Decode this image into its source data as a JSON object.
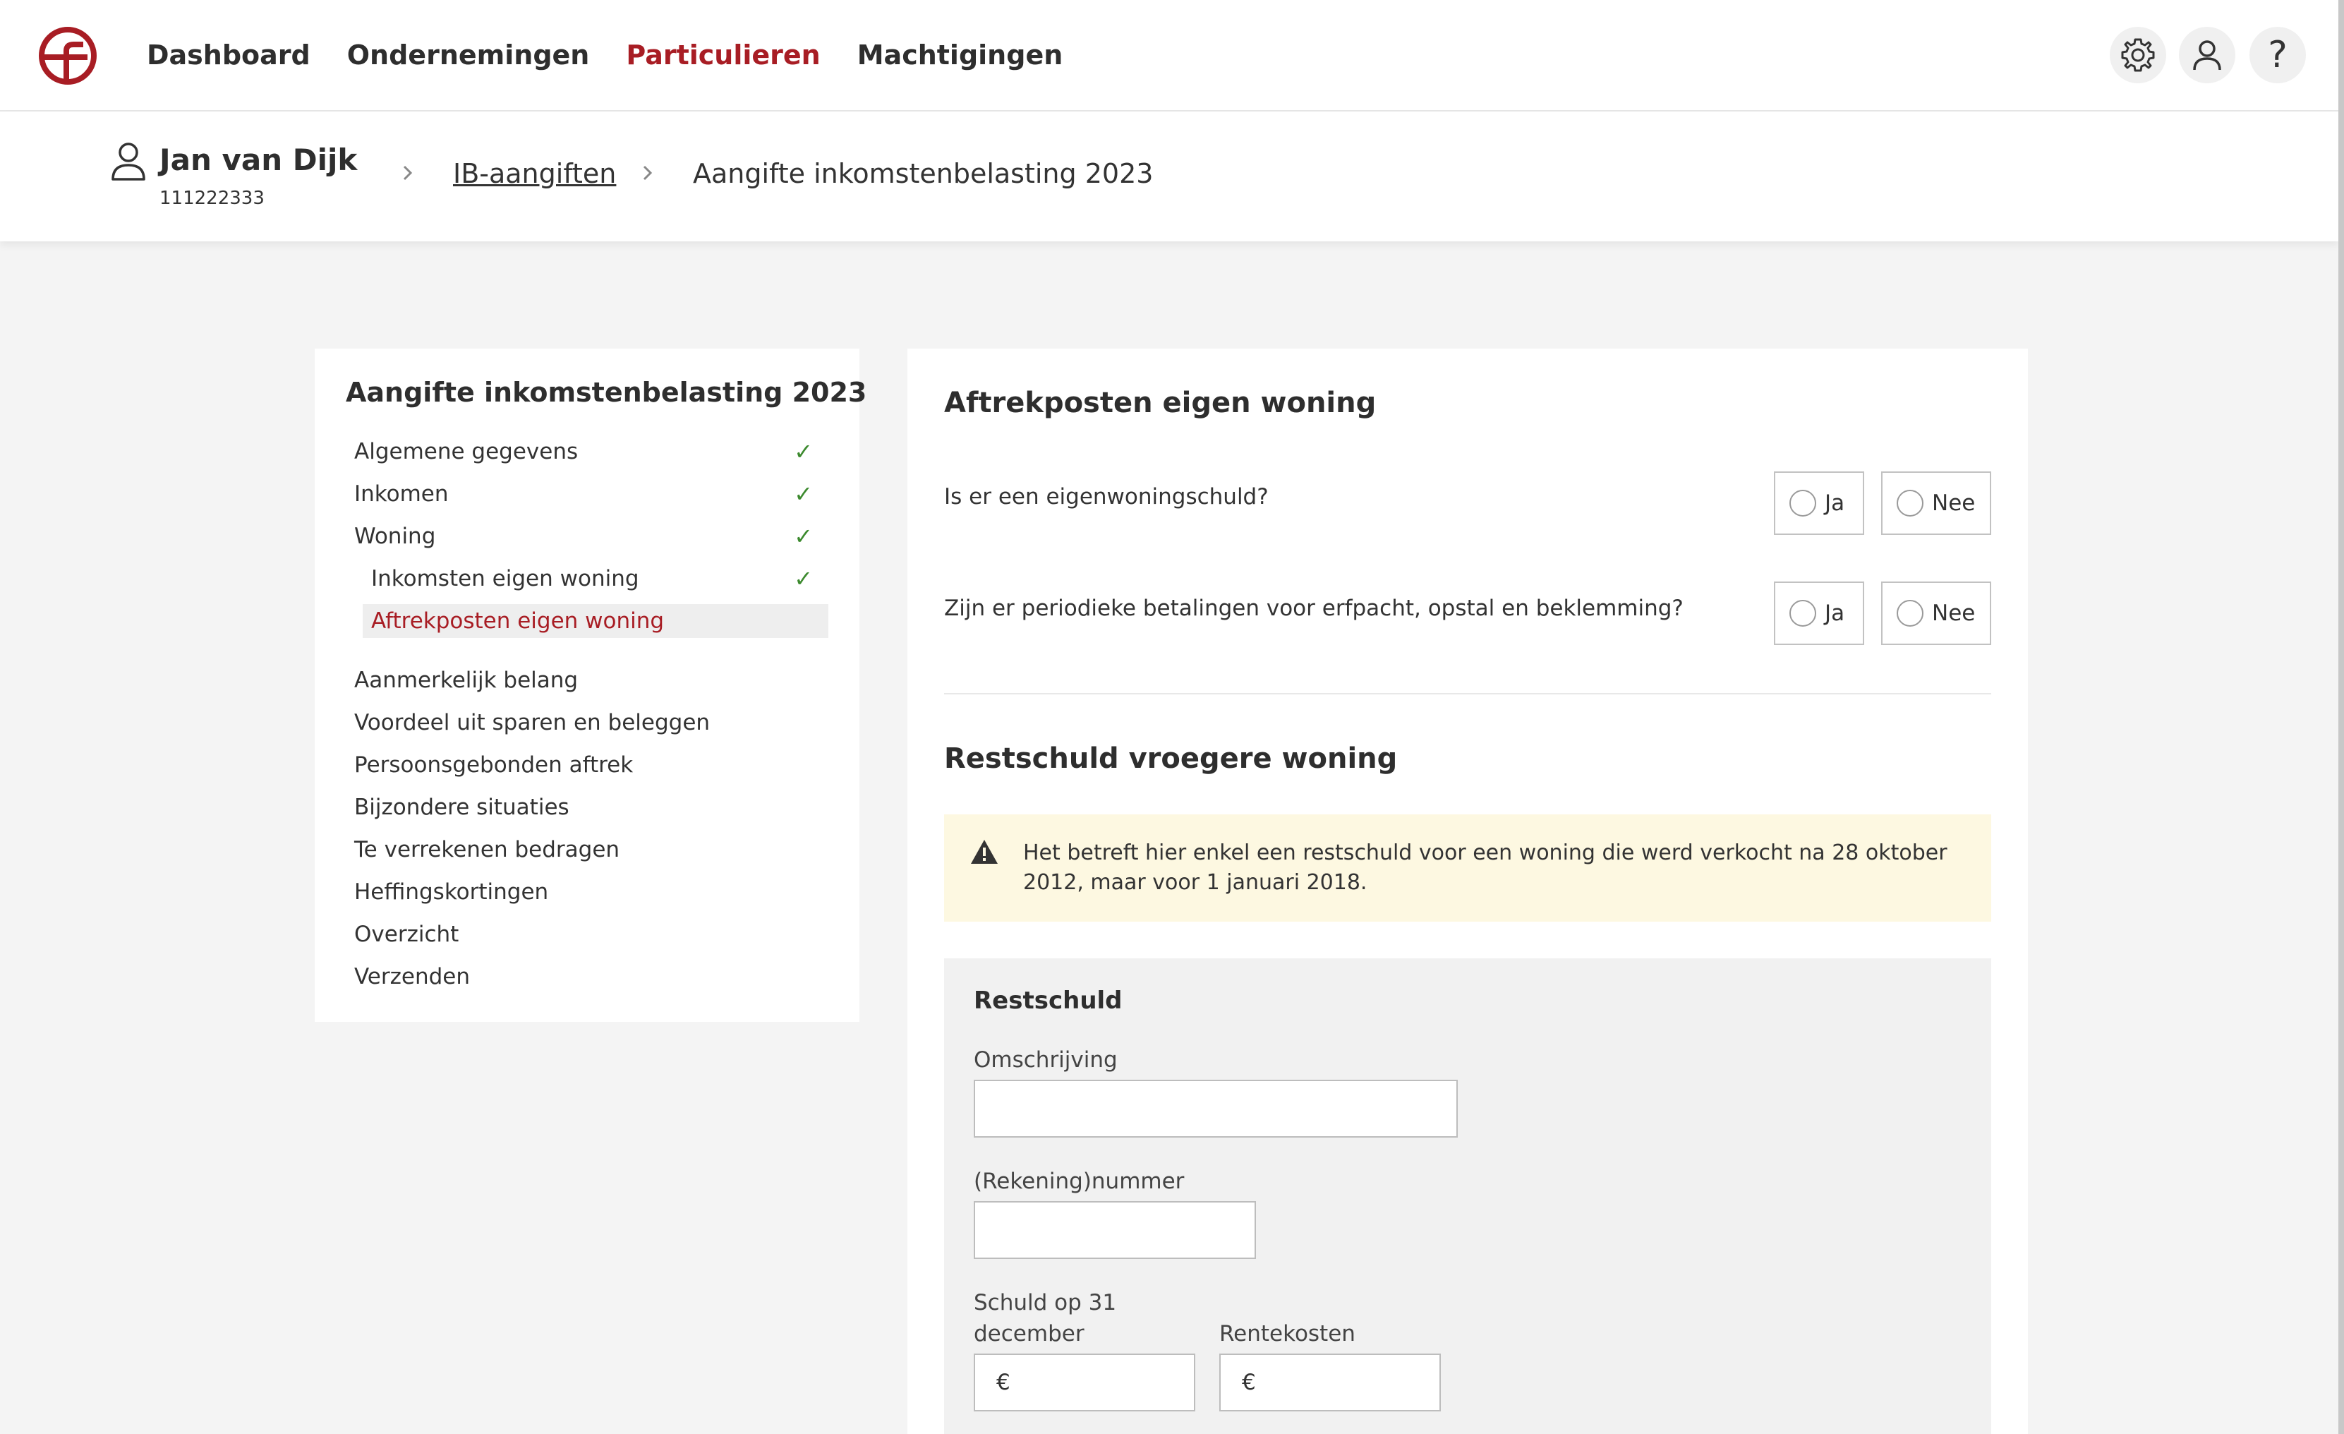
{
  "colors": {
    "brand": "#a81d24",
    "check": "#3c8a2e",
    "notice_bg": "#fdf8e1",
    "page_bg": "#f4f4f4"
  },
  "nav": {
    "items": [
      {
        "label": "Dashboard",
        "active": false
      },
      {
        "label": "Ondernemingen",
        "active": false
      },
      {
        "label": "Particulieren",
        "active": true
      },
      {
        "label": "Machtigingen",
        "active": false
      }
    ],
    "icons": [
      "gear-icon",
      "user-icon",
      "help-icon"
    ],
    "help_glyph": "?"
  },
  "header": {
    "user_name": "Jan van Dijk",
    "user_id": "111222333",
    "breadcrumb": {
      "link": "IB-aangiften",
      "current": "Aangifte inkomstenbelasting 2023"
    }
  },
  "sidebar": {
    "title": "Aangifte inkomstenbelasting 2023",
    "check_glyph": "✓",
    "items": [
      {
        "label": "Algemene gegevens",
        "done": true
      },
      {
        "label": "Inkomen",
        "done": true
      },
      {
        "label": "Woning",
        "done": true
      },
      {
        "label": "Inkomsten eigen woning",
        "done": true,
        "sub": true
      },
      {
        "label": "Aftrekposten eigen woning",
        "done": false,
        "sub": true,
        "active": true
      },
      {
        "label": "Aanmerkelijk belang",
        "done": false
      },
      {
        "label": "Voordeel uit sparen en beleggen",
        "done": false
      },
      {
        "label": "Persoonsgebonden aftrek",
        "done": false
      },
      {
        "label": "Bijzondere situaties",
        "done": false
      },
      {
        "label": "Te verrekenen bedragen",
        "done": false
      },
      {
        "label": "Heffingskortingen",
        "done": false
      },
      {
        "label": "Overzicht",
        "done": false
      },
      {
        "label": "Verzenden",
        "done": false
      }
    ]
  },
  "main": {
    "section1_title": "Aftrekposten eigen woning",
    "questions": [
      {
        "text": "Is er een eigenwoningschuld?",
        "yes": "Ja",
        "no": "Nee"
      },
      {
        "text": "Zijn er periodieke betalingen voor erfpacht, opstal en beklemming?",
        "yes": "Ja",
        "no": "Nee"
      }
    ],
    "section2_title": "Restschuld vroegere woning",
    "notice": "Het betreft hier enkel een restschuld voor een woning die werd verkocht na 28 oktober 2012, maar voor 1 januari 2018.",
    "form": {
      "title": "Restschuld",
      "omschrijving_label": "Omschrijving",
      "omschrijving_value": "",
      "rekening_label": "(Rekening)nummer",
      "rekening_value": "",
      "schuld_label": "Schuld op 31 december",
      "schuld_value": "",
      "rente_label": "Rentekosten",
      "rente_value": "",
      "currency": "€"
    }
  }
}
